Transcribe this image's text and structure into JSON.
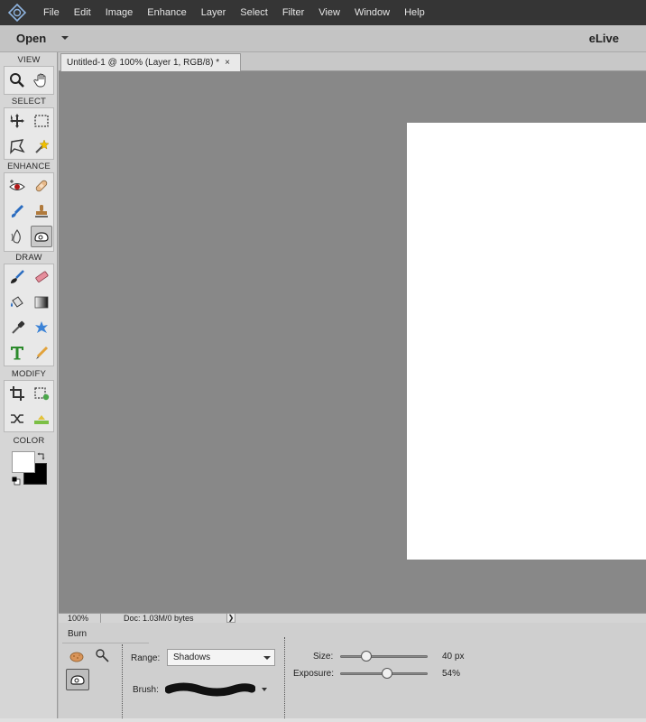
{
  "menu": {
    "items": [
      "File",
      "Edit",
      "Image",
      "Enhance",
      "Layer",
      "Select",
      "Filter",
      "View",
      "Window",
      "Help"
    ]
  },
  "actionbar": {
    "open_label": "Open",
    "elive_label": "eLive"
  },
  "toolbox": {
    "sections": {
      "view": "VIEW",
      "select": "SELECT",
      "enhance": "ENHANCE",
      "draw": "DRAW",
      "modify": "MODIFY",
      "color": "COLOR"
    },
    "tools": {
      "view": [
        "zoom-icon",
        "hand-icon"
      ],
      "select": [
        "move-icon",
        "marquee-icon",
        "lasso-icon",
        "magic-wand-icon"
      ],
      "enhance": [
        "red-eye-icon",
        "spot-healing-icon",
        "smart-brush-icon",
        "clone-stamp-icon",
        "blur-icon",
        "burn-icon"
      ],
      "draw": [
        "brush-icon",
        "eraser-icon",
        "paint-bucket-icon",
        "gradient-icon",
        "color-picker-icon",
        "custom-shape-icon",
        "type-icon",
        "pencil-icon"
      ],
      "modify": [
        "crop-icon",
        "recompose-icon",
        "content-aware-move-icon",
        "straighten-icon"
      ]
    },
    "active_tool": "burn-icon",
    "colors": {
      "foreground": "#ffffff",
      "background": "#000000"
    }
  },
  "document": {
    "tab_title": "Untitled-1 @ 100% (Layer 1, RGB/8) *",
    "close_symbol": "×",
    "canvas_color": "#ffffff",
    "workspace_color": "#888888"
  },
  "statusbar": {
    "zoom": "100%",
    "doc_info": "Doc: 1.03M/0 bytes",
    "arrow": "❯"
  },
  "tool_options": {
    "tool_name": "Burn",
    "range_label": "Range:",
    "range_value": "Shadows",
    "brush_label": "Brush:",
    "size_label": "Size:",
    "size_value": "40 px",
    "size_fraction": 0.3,
    "exposure_label": "Exposure:",
    "exposure_value": "54%",
    "exposure_fraction": 0.54
  }
}
